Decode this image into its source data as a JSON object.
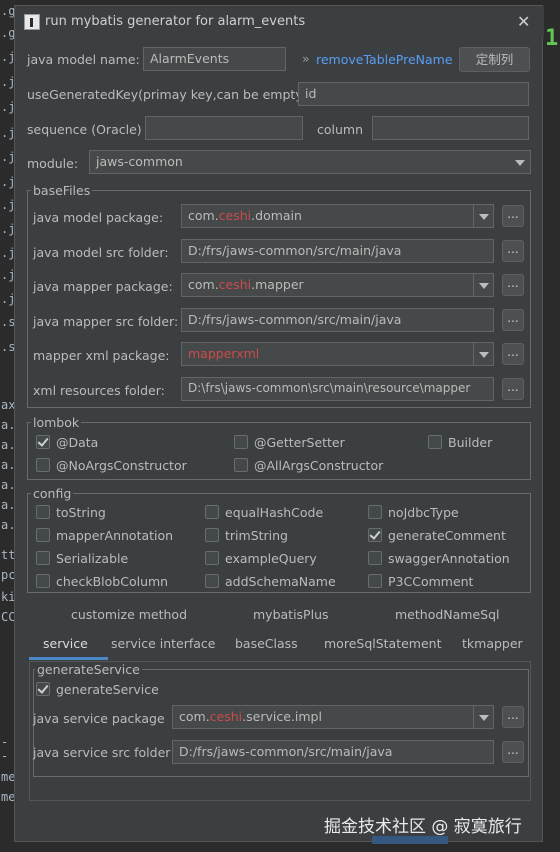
{
  "title": "run mybatis generator for alarm_events",
  "close": "✕",
  "java_model_name": {
    "label": "java model name:",
    "value": "AlarmEvents"
  },
  "remove_prefix": {
    "arrow": "»",
    "label": "removeTablePreName"
  },
  "custom_col_btn": "定制列",
  "use_generated_key": {
    "label": "useGeneratedKey(primay key,can be empty):",
    "value": "id"
  },
  "sequence": {
    "label": "sequence (Oracle)",
    "value": "",
    "column_label": "column",
    "column_value": ""
  },
  "module": {
    "label": "module:",
    "value": "jaws-common"
  },
  "basefiles": {
    "title": "baseFiles",
    "model_pkg": {
      "label": "java model package:",
      "pre": "com.",
      "mid": "ceshi",
      "post": ".domain"
    },
    "model_src": {
      "label": "java model src folder:",
      "value": "D:/frs/jaws-common/src/main/java"
    },
    "mapper_pkg": {
      "label": "java mapper package:",
      "pre": "com.",
      "mid": "ceshi",
      "post": ".mapper"
    },
    "mapper_src": {
      "label": "java mapper src folder:",
      "value": "D:/frs/jaws-common/src/main/java"
    },
    "xml_pkg": {
      "label": "mapper xml package:",
      "value": "mapperxml"
    },
    "xml_folder": {
      "label": "xml resources folder:",
      "value": "D:\\frs\\jaws-common\\src\\main\\resource\\mapper"
    },
    "browse": "..."
  },
  "lombok": {
    "title": "lombok",
    "data": "@Data",
    "getter_setter": "@GetterSetter",
    "builder": "Builder",
    "no_args": "@NoArgsConstructor",
    "all_args": "@AllArgsConstructor"
  },
  "config": {
    "title": "config",
    "items": [
      "toString",
      "equalHashCode",
      "noJdbcType",
      "mapperAnnotation",
      "trimString",
      "generateComment",
      "Serializable",
      "exampleQuery",
      "swaggerAnnotation",
      "checkBlobColumn",
      "addSchemaName",
      "P3CComment"
    ]
  },
  "tabs_row1": [
    "customize method",
    "mybatisPlus",
    "methodNameSql"
  ],
  "tabs_row2": [
    "service",
    "service interface",
    "baseClass",
    "moreSqlStatement",
    "tkmapper"
  ],
  "generate_service": {
    "title": "generateService",
    "check_label": "generateService",
    "pkg_label": "java service package",
    "pkg_pre": "com.",
    "pkg_mid": "ceshi",
    "pkg_post": ".service.impl",
    "src_label": "java service src folder",
    "src_value": "D:/frs/jaws-common/src/main/java"
  },
  "watermark": "掘金技术社区 @ 寂寞旅行",
  "gutter": [
    ".g",
    ".g",
    ".j",
    ".j",
    ".j",
    ".j",
    ".j",
    ".j",
    ".j",
    ".j",
    ".j",
    ".j",
    ".j",
    ".s",
    ".s",
    "ax",
    "a.",
    "a.",
    "a.",
    "a.",
    "a.",
    "a.",
    "tt",
    "pc",
    "ki",
    "CC",
    "--",
    "me",
    "me"
  ],
  "right_number": "1"
}
